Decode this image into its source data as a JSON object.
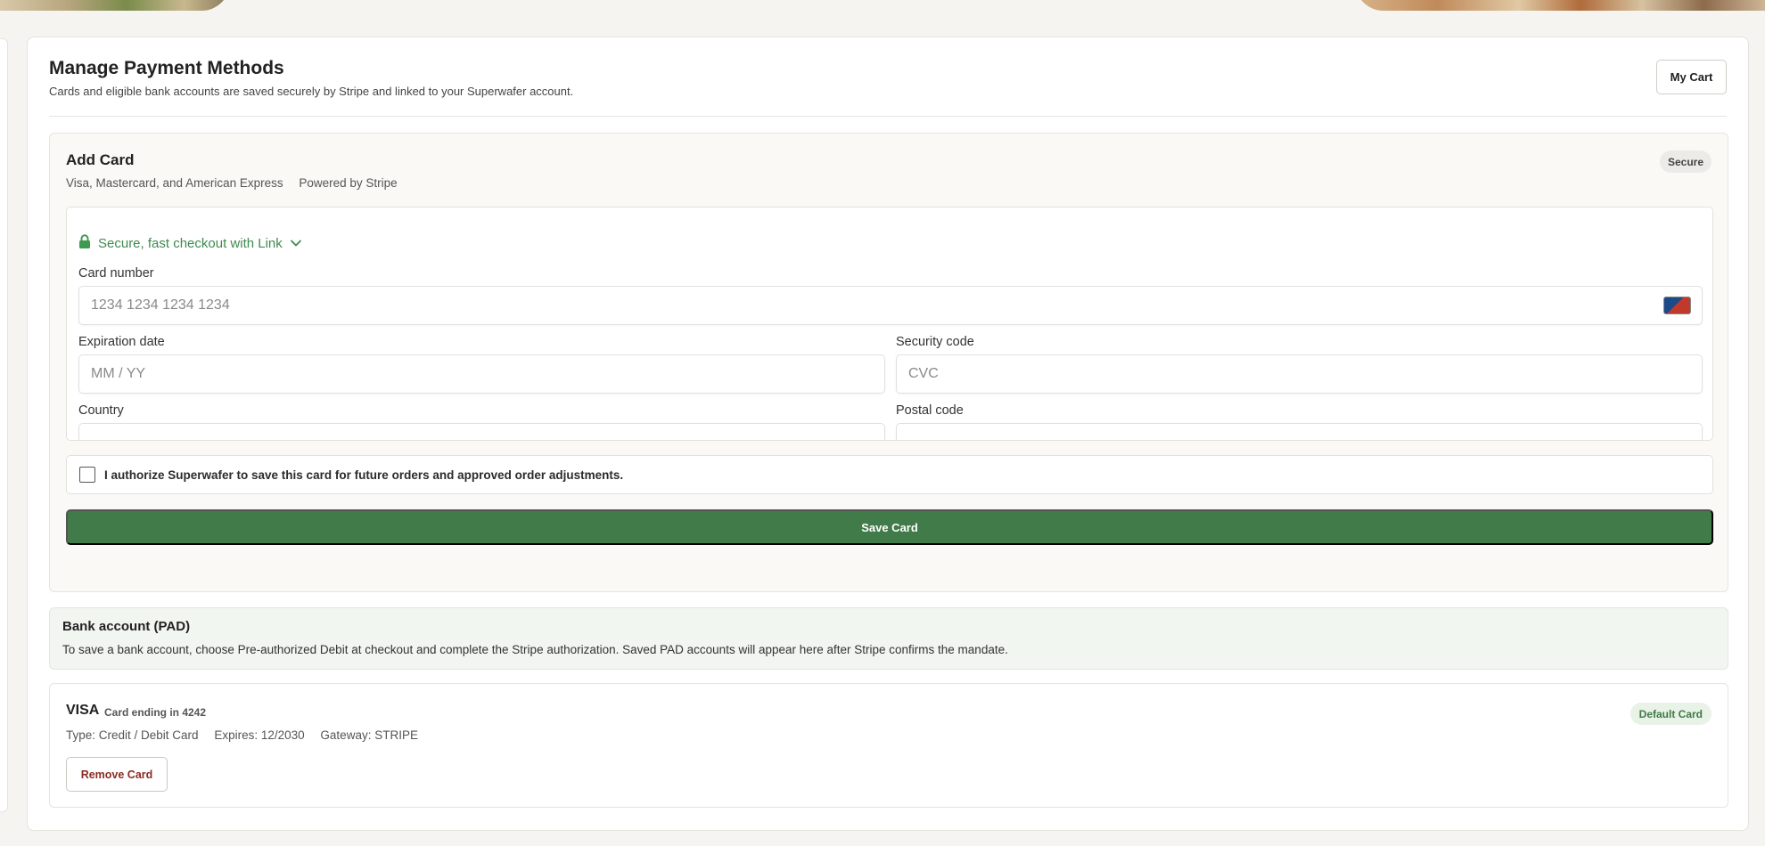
{
  "header": {
    "title": "Manage Payment Methods",
    "subtitle": "Cards and eligible bank accounts are saved securely by Stripe and linked to your Superwafer account.",
    "cart_button": "My Cart"
  },
  "add_card": {
    "title": "Add Card",
    "networks": "Visa, Mastercard, and American Express",
    "powered_by": "Powered by Stripe",
    "badge": "Secure",
    "link_text": "Secure, fast checkout with Link",
    "card_number": {
      "label": "Card number",
      "placeholder": "1234 1234 1234 1234"
    },
    "expiration": {
      "label": "Expiration date",
      "placeholder": "MM / YY"
    },
    "security": {
      "label": "Security code",
      "placeholder": "CVC"
    },
    "country": {
      "label": "Country"
    },
    "postal": {
      "label": "Postal code"
    },
    "authorize_text": "I authorize Superwafer to save this card for future orders and approved order adjustments.",
    "authorize_checked": false,
    "save_button": "Save Card"
  },
  "bank": {
    "title": "Bank account (PAD)",
    "text": "To save a bank account, choose Pre-authorized Debit at checkout and complete the Stripe authorization. Saved PAD accounts will appear here after Stripe confirms the mandate."
  },
  "saved_card": {
    "brand": "VISA",
    "ending": "Card ending in 4242",
    "type": "Type: Credit / Debit Card",
    "expires": "Expires: 12/2030",
    "gateway": "Gateway: STRIPE",
    "badge": "Default Card",
    "remove_button": "Remove Card"
  },
  "colors": {
    "accent_green": "#427b4a",
    "link_green": "#3e8a4f",
    "remove_red": "#8a2c22",
    "page_bg": "#f5f4f0"
  },
  "icons": [
    "lock-icon",
    "chevron-down-icon",
    "card-brand-icon"
  ]
}
